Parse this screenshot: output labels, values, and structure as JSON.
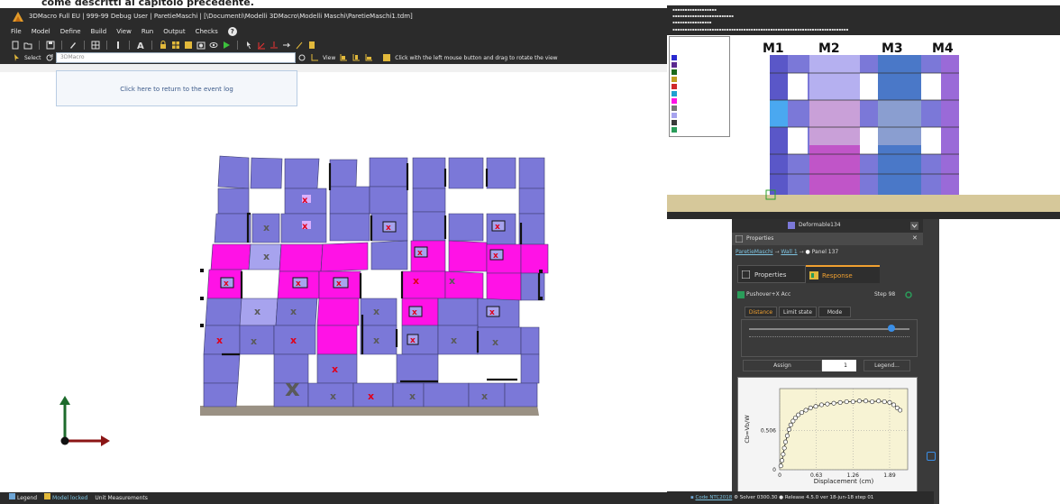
{
  "caption": "come descritti al capitolo precedente.",
  "main_window": {
    "title": "3DMacro Full EU | 999-99 Debug User | ParetieMaschi | [\\Documenti\\Modelli 3DMacro\\Modelli Maschi\\ParetieMaschi1.tdm]",
    "menu": [
      "File",
      "Model",
      "Define",
      "Build",
      "View",
      "Run",
      "Output",
      "Checks"
    ],
    "help_glyph": "?",
    "toolbar2": {
      "select_label": "Select",
      "command_placeholder": "3DMacro",
      "view_label": "View",
      "hint": "Click with the left mouse button and drag to rotate the view"
    },
    "event_log_text": "Click here to return to the event log",
    "status": {
      "legend": "Legend",
      "model_locked": "Model locked",
      "units": "Unit Measurements"
    }
  },
  "elevation": {
    "labels": [
      "M1",
      "M2",
      "M3",
      "M4"
    ]
  },
  "properties_panel": {
    "dropdown_value": "Deformable134",
    "title": "Properties",
    "breadcrumb": [
      "ParetieMaschi",
      "Wall 1",
      "Panel 137"
    ],
    "tabs": [
      "Properties",
      "Response"
    ],
    "analysis": "Pushover+X Acc",
    "step": "Step 98",
    "inner_tabs": [
      "Distance",
      "Limit state",
      "Mode"
    ],
    "assign_label": "Assign",
    "assign_value": "1",
    "legend_button": "Legend..."
  },
  "chart_data": {
    "type": "scatter",
    "xlabel": "Displacement (cm)",
    "ylabel": "Cb=Vb/W",
    "x_ticks": [
      "0",
      "0.63",
      "1.26",
      "1.89"
    ],
    "y_ticks": [
      "0",
      "0.506"
    ],
    "xlim": [
      0,
      2.2
    ],
    "ylim": [
      0,
      1.05
    ],
    "points": [
      [
        0.02,
        0.05
      ],
      [
        0.04,
        0.12
      ],
      [
        0.06,
        0.2
      ],
      [
        0.08,
        0.28
      ],
      [
        0.1,
        0.36
      ],
      [
        0.13,
        0.44
      ],
      [
        0.16,
        0.52
      ],
      [
        0.19,
        0.58
      ],
      [
        0.23,
        0.63
      ],
      [
        0.27,
        0.67
      ],
      [
        0.32,
        0.71
      ],
      [
        0.38,
        0.74
      ],
      [
        0.45,
        0.77
      ],
      [
        0.53,
        0.8
      ],
      [
        0.62,
        0.82
      ],
      [
        0.72,
        0.84
      ],
      [
        0.82,
        0.85
      ],
      [
        0.93,
        0.86
      ],
      [
        1.04,
        0.87
      ],
      [
        1.15,
        0.88
      ],
      [
        1.26,
        0.88
      ],
      [
        1.37,
        0.89
      ],
      [
        1.48,
        0.89
      ],
      [
        1.59,
        0.88
      ],
      [
        1.7,
        0.89
      ],
      [
        1.8,
        0.88
      ],
      [
        1.89,
        0.87
      ],
      [
        1.96,
        0.84
      ],
      [
        2.02,
        0.8
      ],
      [
        2.07,
        0.77
      ]
    ]
  },
  "bottom_status": {
    "code": "Code NTC2018",
    "solver": "Solver 0300.30",
    "release": "Release 4.5.0 ver 18-jun-18 step 01"
  },
  "colors": {
    "panel_blue": "#7b78d8",
    "panel_magenta": "#ff12e6",
    "ground": "#9a9184"
  }
}
